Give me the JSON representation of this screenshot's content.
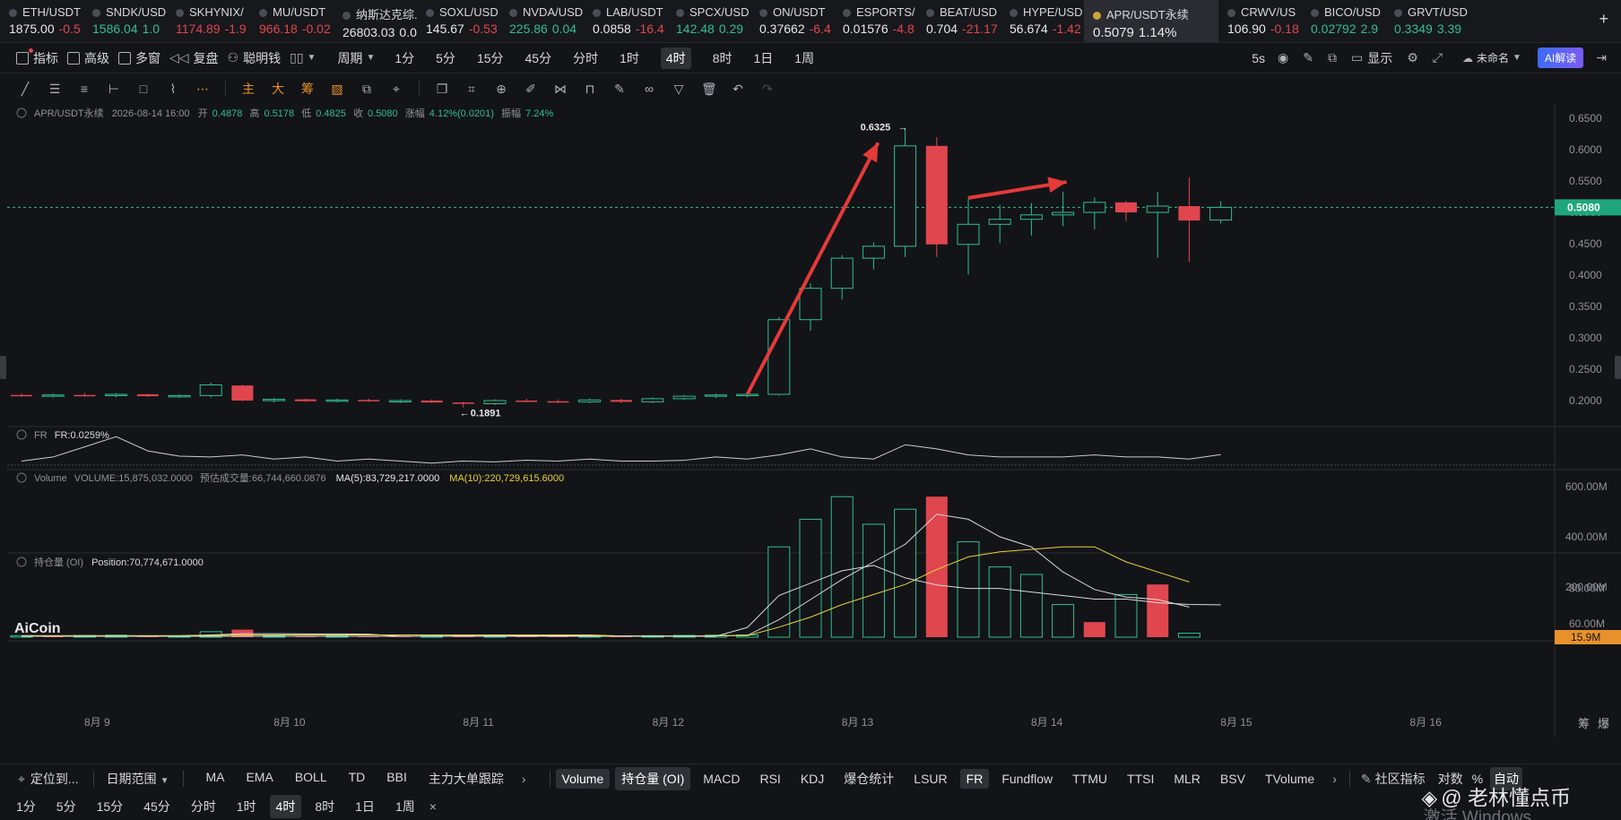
{
  "tickers": [
    {
      "name": "ETH/USDT",
      "price": "1875.00",
      "change": "-0.5",
      "dir": "neg"
    },
    {
      "name": "SNDK/USD",
      "price": "1586.04",
      "change": "1.0",
      "dir": "pos"
    },
    {
      "name": "SKHYNIX/",
      "price": "1174.89",
      "change": "-1.9",
      "dir": "neg"
    },
    {
      "name": "MU/USDT",
      "price": "966.18",
      "change": "-0.02",
      "dir": "neg"
    },
    {
      "name": "纳斯达克综...",
      "price": "26803.03",
      "change": "0.0",
      "dir": "flat"
    },
    {
      "name": "SOXL/USD",
      "price": "145.67",
      "change": "-0.53",
      "dir": "neg"
    },
    {
      "name": "NVDA/USD",
      "price": "225.86",
      "change": "0.04",
      "dir": "pos"
    },
    {
      "name": "LAB/USDT",
      "price": "0.0858",
      "change": "-16.4",
      "dir": "neg"
    },
    {
      "name": "SPCX/USD",
      "price": "142.48",
      "change": "0.29",
      "dir": "pos"
    },
    {
      "name": "ON/USDT",
      "price": "0.37662",
      "change": "-6.4",
      "dir": "neg"
    },
    {
      "name": "ESPORTS/",
      "price": "0.01576",
      "change": "-4.8",
      "dir": "neg"
    },
    {
      "name": "BEAT/USD",
      "price": "0.704",
      "change": "-21.17",
      "dir": "neg"
    },
    {
      "name": "HYPE/USD",
      "price": "56.674",
      "change": "-1.42",
      "dir": "neg"
    },
    {
      "name": "APR/USDT永续",
      "price": "0.5079",
      "change": "1.14%",
      "dir": "pos",
      "active": true
    },
    {
      "name": "CRWV/US",
      "price": "106.90",
      "change": "-0.18",
      "dir": "neg"
    },
    {
      "name": "BICO/USD",
      "price": "0.02792",
      "change": "2.9",
      "dir": "pos"
    },
    {
      "name": "GRVT/USD",
      "price": "0.3349",
      "change": "3.39",
      "dir": "pos"
    }
  ],
  "toolbar": {
    "indicators": "指标",
    "advanced": "高级",
    "multi": "多窗",
    "replay": "复盘",
    "smart": "聪明钱",
    "period_label": "周期",
    "periods": [
      "1分",
      "5分",
      "15分",
      "45分",
      "分时",
      "1时",
      "4时",
      "8时",
      "1日",
      "1周"
    ],
    "selected_period": "4时",
    "refresh": "5s",
    "display": "显示",
    "unnamed": "未命名",
    "ai": "AI解读"
  },
  "chart_header": {
    "symbol": "APR/USDT永续",
    "datetime": "2026-08-14 16:00",
    "open_label": "开",
    "open": "0.4878",
    "high_label": "高",
    "high": "0.5178",
    "low_label": "低",
    "low": "0.4825",
    "close_label": "收",
    "close": "0.5080",
    "change_label": "涨幅",
    "change": "4.12%(0.0201)",
    "amp_label": "振幅",
    "amp": "7.24%"
  },
  "fr_panel": {
    "name": "FR",
    "value": "FR:0.0259%"
  },
  "vol_panel": {
    "name": "Volume",
    "volume": "VOLUME:15,875,032.0000",
    "est": "预估成交量:66,744,660.0876",
    "ma5": "MA(5):83,729,217.0000",
    "ma10": "MA(10):220,729,615.6000",
    "last_label": "15.9M"
  },
  "oi_panel": {
    "name": "持仓量 (OI)",
    "value": "Position:70,774,671.0000"
  },
  "logo": "AiCoin",
  "chart_data": {
    "type": "candlestick",
    "timeframe": "4时",
    "current_price": 0.508,
    "current_price_label": "0.5080",
    "high_marker": {
      "value": 0.6325,
      "label": "0.6325"
    },
    "low_marker": {
      "value": 0.1891,
      "label": "0.1891"
    },
    "price_ticks": [
      "0.6500",
      "0.6000",
      "0.5500",
      "0.5000",
      "0.4500",
      "0.4000",
      "0.3500",
      "0.3000",
      "0.2500",
      "0.2000"
    ],
    "price_tick_values": [
      0.65,
      0.6,
      0.55,
      0.5,
      0.45,
      0.4,
      0.35,
      0.3,
      0.25,
      0.2
    ],
    "x_ticks": [
      "8月 9",
      "8月 10",
      "8月 11",
      "8月 12",
      "8月 13",
      "8月 14",
      "8月 15",
      "8月 16"
    ],
    "x_tick_index": [
      2.5,
      8.5,
      14.5,
      20.5,
      26.5,
      32.5,
      38.5,
      44.5
    ],
    "candles": [
      {
        "o": 0.209,
        "h": 0.211,
        "l": 0.206,
        "c": 0.208
      },
      {
        "o": 0.208,
        "h": 0.211,
        "l": 0.205,
        "c": 0.209
      },
      {
        "o": 0.209,
        "h": 0.212,
        "l": 0.206,
        "c": 0.208
      },
      {
        "o": 0.208,
        "h": 0.212,
        "l": 0.205,
        "c": 0.21
      },
      {
        "o": 0.21,
        "h": 0.211,
        "l": 0.206,
        "c": 0.207
      },
      {
        "o": 0.207,
        "h": 0.21,
        "l": 0.204,
        "c": 0.208
      },
      {
        "o": 0.208,
        "h": 0.229,
        "l": 0.205,
        "c": 0.225
      },
      {
        "o": 0.224,
        "h": 0.225,
        "l": 0.199,
        "c": 0.2
      },
      {
        "o": 0.2,
        "h": 0.204,
        "l": 0.197,
        "c": 0.202
      },
      {
        "o": 0.202,
        "h": 0.203,
        "l": 0.198,
        "c": 0.199
      },
      {
        "o": 0.199,
        "h": 0.203,
        "l": 0.197,
        "c": 0.201
      },
      {
        "o": 0.201,
        "h": 0.203,
        "l": 0.198,
        "c": 0.199
      },
      {
        "o": 0.199,
        "h": 0.202,
        "l": 0.196,
        "c": 0.2
      },
      {
        "o": 0.2,
        "h": 0.202,
        "l": 0.196,
        "c": 0.197
      },
      {
        "o": 0.197,
        "h": 0.198,
        "l": 0.189,
        "c": 0.195
      },
      {
        "o": 0.195,
        "h": 0.202,
        "l": 0.193,
        "c": 0.2
      },
      {
        "o": 0.2,
        "h": 0.203,
        "l": 0.197,
        "c": 0.199
      },
      {
        "o": 0.199,
        "h": 0.202,
        "l": 0.196,
        "c": 0.198
      },
      {
        "o": 0.198,
        "h": 0.203,
        "l": 0.196,
        "c": 0.201
      },
      {
        "o": 0.201,
        "h": 0.203,
        "l": 0.196,
        "c": 0.198
      },
      {
        "o": 0.198,
        "h": 0.205,
        "l": 0.196,
        "c": 0.203
      },
      {
        "o": 0.203,
        "h": 0.209,
        "l": 0.201,
        "c": 0.207
      },
      {
        "o": 0.207,
        "h": 0.211,
        "l": 0.204,
        "c": 0.209
      },
      {
        "o": 0.209,
        "h": 0.212,
        "l": 0.205,
        "c": 0.21
      },
      {
        "o": 0.21,
        "h": 0.333,
        "l": 0.208,
        "c": 0.329
      },
      {
        "o": 0.329,
        "h": 0.387,
        "l": 0.311,
        "c": 0.379
      },
      {
        "o": 0.379,
        "h": 0.432,
        "l": 0.361,
        "c": 0.427
      },
      {
        "o": 0.427,
        "h": 0.452,
        "l": 0.409,
        "c": 0.446
      },
      {
        "o": 0.446,
        "h": 0.6325,
        "l": 0.429,
        "c": 0.606
      },
      {
        "o": 0.606,
        "h": 0.62,
        "l": 0.429,
        "c": 0.449
      },
      {
        "o": 0.449,
        "h": 0.522,
        "l": 0.401,
        "c": 0.481
      },
      {
        "o": 0.481,
        "h": 0.512,
        "l": 0.451,
        "c": 0.489
      },
      {
        "o": 0.489,
        "h": 0.515,
        "l": 0.463,
        "c": 0.496
      },
      {
        "o": 0.496,
        "h": 0.533,
        "l": 0.478,
        "c": 0.5
      },
      {
        "o": 0.5,
        "h": 0.524,
        "l": 0.473,
        "c": 0.516
      },
      {
        "o": 0.516,
        "h": 0.518,
        "l": 0.486,
        "c": 0.5
      },
      {
        "o": 0.5,
        "h": 0.533,
        "l": 0.428,
        "c": 0.51
      },
      {
        "o": 0.51,
        "h": 0.556,
        "l": 0.421,
        "c": 0.487
      },
      {
        "o": 0.4878,
        "h": 0.5178,
        "l": 0.4825,
        "c": 0.508
      }
    ],
    "volume": {
      "ticks": [
        "600.00M",
        "400.00M",
        "200.00M"
      ],
      "tick_values": [
        600,
        400,
        200
      ],
      "values": [
        6,
        5,
        7,
        8,
        6,
        5,
        22,
        30,
        5,
        4,
        5,
        4,
        4,
        5,
        8,
        6,
        5,
        4,
        5,
        5,
        6,
        7,
        8,
        9,
        360,
        470,
        560,
        450,
        510,
        560,
        380,
        280,
        250,
        130,
        60,
        170,
        210,
        15.9
      ],
      "ma5": [
        6,
        6,
        6,
        6,
        6,
        6,
        9,
        14,
        14,
        13,
        13,
        12,
        4,
        4,
        5,
        5,
        6,
        6,
        6,
        5,
        5,
        5,
        6,
        7,
        70,
        150,
        230,
        300,
        370,
        490,
        470,
        400,
        360,
        260,
        190,
        160,
        150,
        120
      ],
      "ma10": [
        6,
        6,
        6,
        6,
        6,
        6,
        7,
        9,
        9,
        9,
        9,
        9,
        9,
        9,
        9,
        9,
        9,
        9,
        9,
        5,
        5,
        5,
        6,
        6,
        40,
        80,
        130,
        170,
        210,
        270,
        320,
        340,
        350,
        360,
        360,
        300,
        260,
        220
      ],
      "colors": [
        "g",
        "r",
        "g",
        "g",
        "r",
        "g",
        "g",
        "r",
        "g",
        "r",
        "g",
        "r",
        "r",
        "g",
        "r",
        "g",
        "r",
        "r",
        "g",
        "r",
        "g",
        "g",
        "g",
        "g",
        "g",
        "g",
        "g",
        "g",
        "g",
        "r",
        "g",
        "g",
        "g",
        "g",
        "r",
        "g",
        "r",
        "g"
      ]
    },
    "fr_values": [
      0.01,
      0.02,
      0.045,
      0.07,
      0.035,
      0.022,
      0.02,
      0.025,
      0.015,
      0.02,
      0.01,
      0.015,
      0.01,
      0.005,
      0.01,
      0.008,
      0.012,
      0.01,
      0.015,
      0.01,
      0.01,
      0.012,
      0.02,
      0.015,
      0.025,
      0.04,
      0.02,
      0.015,
      0.05,
      0.04,
      0.025,
      0.02,
      0.02,
      0.02,
      0.025,
      0.02,
      0.02,
      0.015,
      0.0259
    ],
    "oi": {
      "ticks": [
        "80.00M",
        "60.00M"
      ],
      "tick_values": [
        80,
        60
      ],
      "values": [
        53,
        53,
        53,
        53,
        53,
        53,
        53,
        53,
        53,
        53,
        53,
        53,
        53,
        53,
        53,
        53,
        53,
        53,
        53,
        53,
        53,
        53,
        53,
        58,
        76,
        83,
        90,
        93,
        86,
        82,
        80,
        80,
        78,
        76,
        74,
        74,
        72,
        71,
        70.8
      ]
    }
  },
  "bottom": {
    "locate": "定位到...",
    "date_range": "日期范围",
    "indicators": [
      "MA",
      "EMA",
      "BOLL",
      "TD",
      "BBI",
      "主力大单跟踪"
    ],
    "subs": [
      "Volume",
      "持仓量 (OI)",
      "MACD",
      "RSI",
      "KDJ",
      "爆仓统计",
      "LSUR",
      "FR",
      "Fundflow",
      "TTMU",
      "TTSI",
      "MLR",
      "BSV",
      "TVolume"
    ],
    "community": "社区指标",
    "log": "对数",
    "pct": "%",
    "auto": "自动",
    "periods": [
      "1分",
      "5分",
      "15分",
      "45分",
      "分时",
      "1时",
      "4时",
      "8时",
      "1日",
      "1周"
    ],
    "selected": "4时",
    "close_x": "×",
    "right_labels": [
      "筹",
      "爆"
    ]
  },
  "watermark": "@ 老林懂点币",
  "activation": "激活 Windows"
}
